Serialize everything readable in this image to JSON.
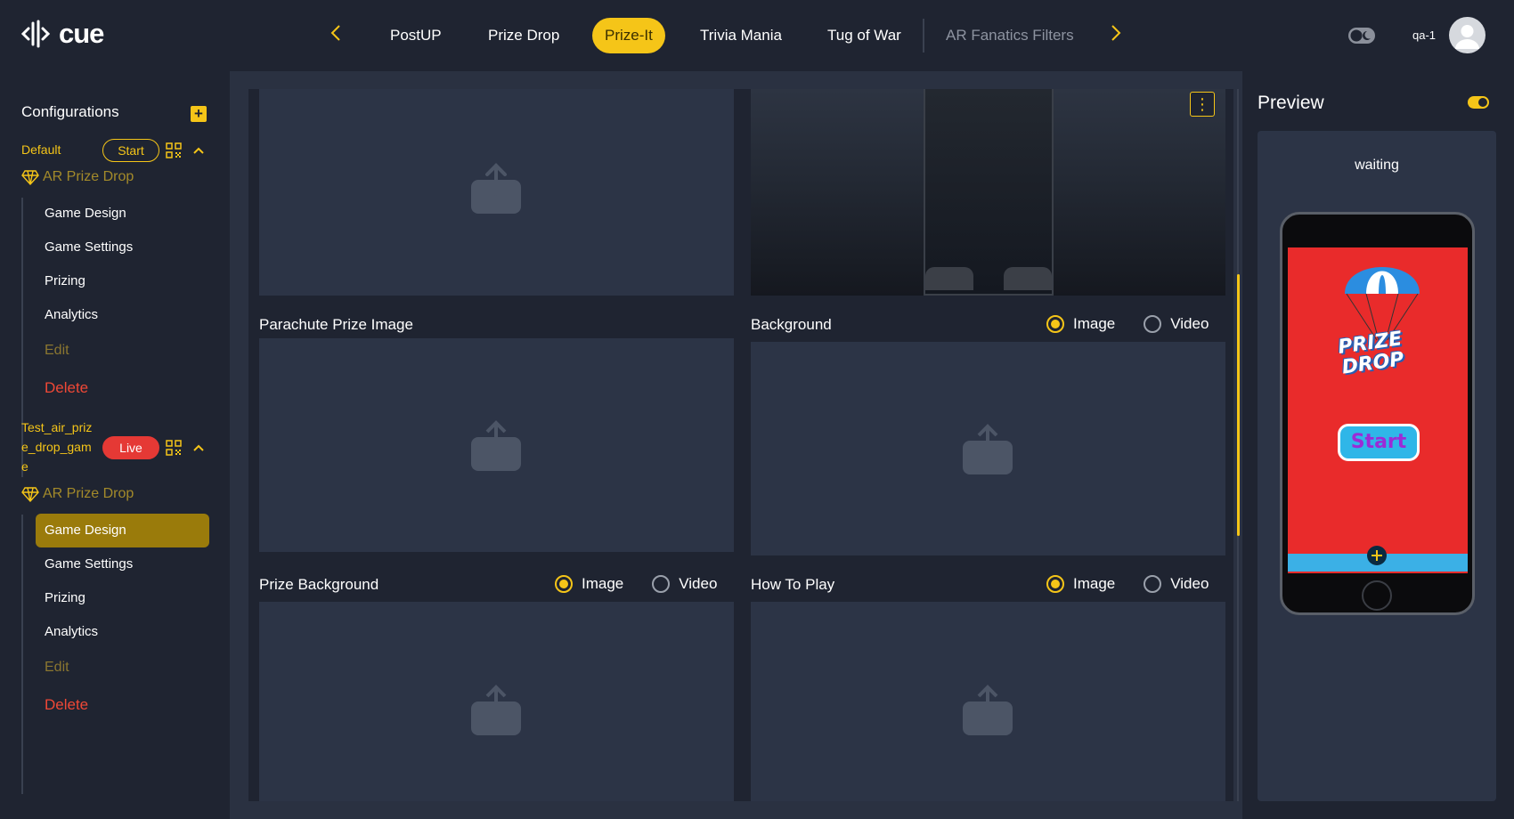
{
  "app": {
    "logo_text": "cue"
  },
  "nav": {
    "tabs": [
      {
        "label": "PostUP"
      },
      {
        "label": "Prize Drop"
      },
      {
        "label": "Prize-It",
        "active": true
      },
      {
        "label": "Trivia Mania"
      },
      {
        "label": "Tug of War"
      },
      {
        "label": "AR Fanatics Filters"
      }
    ]
  },
  "user": {
    "name": "qa-1"
  },
  "sidebar": {
    "title": "Configurations",
    "configs": [
      {
        "name": "Default",
        "status": "Start",
        "game_type": "AR Prize Drop",
        "items": [
          "Game Design",
          "Game Settings",
          "Prizing",
          "Analytics",
          "Edit",
          "Delete"
        ]
      },
      {
        "name_lines": [
          "Test_air_priz",
          "e_drop_gam",
          "e"
        ],
        "status": "Live",
        "game_type": "AR Prize Drop",
        "items": [
          "Game Design",
          "Game Settings",
          "Prizing",
          "Analytics",
          "Edit",
          "Delete"
        ],
        "active_item": "Game Design"
      }
    ]
  },
  "main": {
    "fields": {
      "parachute": {
        "label": "Parachute Prize Image"
      },
      "background": {
        "label": "Background",
        "options": [
          "Image",
          "Video"
        ],
        "selected": "Image"
      },
      "prize_background": {
        "label": "Prize Background",
        "options": [
          "Image",
          "Video"
        ],
        "selected": "Image"
      },
      "how_to_play": {
        "label": "How To Play",
        "options": [
          "Image",
          "Video"
        ],
        "selected": "Image"
      }
    }
  },
  "preview": {
    "title": "Preview",
    "status": "waiting",
    "game_title_lines": [
      "PRIZE",
      "DROP"
    ],
    "start_label": "Start"
  },
  "colors": {
    "accent": "#f5c518",
    "live": "#e53935",
    "delete": "#ef4836",
    "background": "#1f2431",
    "panel": "#2a3141"
  }
}
